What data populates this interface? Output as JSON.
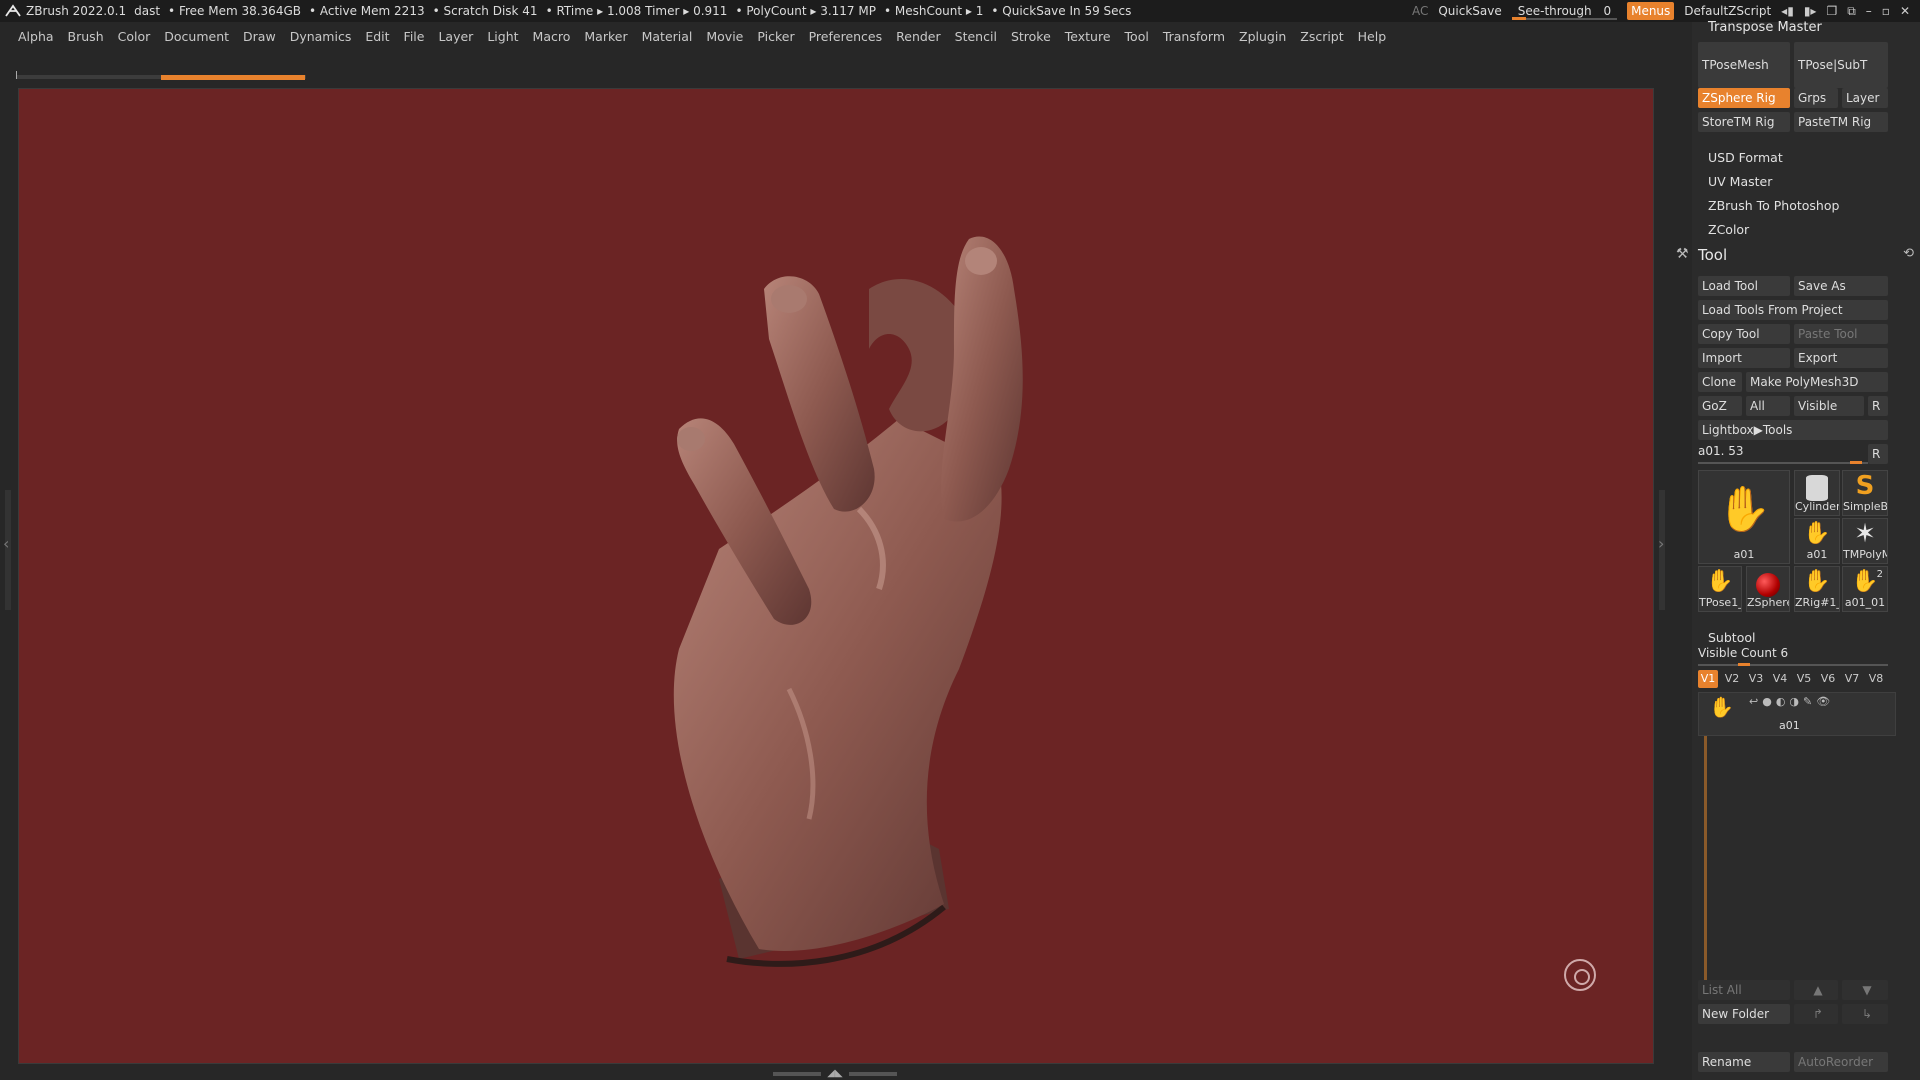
{
  "titlebar": {
    "app": "ZBrush 2022.0.1",
    "file": "dast",
    "free_mem": "• Free Mem 38.364GB",
    "active_mem": "• Active Mem 2213",
    "scratch": "• Scratch Disk 41",
    "rtime": "• RTime ▸ 1.008 Timer ▸ 0.911",
    "polycount": "• PolyCount ▸ 3.117 MP",
    "meshcount": "• MeshCount ▸ 1",
    "quicksave_in": "• QuickSave In 59 Secs",
    "ac": "AC",
    "quicksave": "QuickSave",
    "see_through_label": "See-through",
    "see_through_value": "0",
    "menus": "Menus",
    "default_zscript": "DefaultZScript"
  },
  "menubar": [
    "Alpha",
    "Brush",
    "Color",
    "Document",
    "Draw",
    "Dynamics",
    "Edit",
    "File",
    "Layer",
    "Light",
    "Macro",
    "Marker",
    "Material",
    "Movie",
    "Picker",
    "Preferences",
    "Render",
    "Stencil",
    "Stroke",
    "Texture",
    "Tool",
    "Transform",
    "Zplugin",
    "Zscript",
    "Help"
  ],
  "colors": {
    "accent": "#e8822d",
    "viewport_bg": "#6b2424",
    "panel_bg": "#2b2b2b"
  },
  "transpose_master": {
    "title": "Transpose Master",
    "tposemesh": "TPoseMesh",
    "tpose_subt": "TPose|SubT",
    "zsphere_rig": "ZSphere Rig",
    "grps": "Grps",
    "layer": "Layer",
    "store_tm_rig": "StoreTM Rig",
    "paste_tm_rig": "PasteTM Rig"
  },
  "plugins": {
    "usd_format": "USD Format",
    "uv_master": "UV Master",
    "zbrush_to_photoshop": "ZBrush To Photoshop",
    "zcolor": "ZColor"
  },
  "tool": {
    "title": "Tool",
    "load_tool": "Load Tool",
    "save_as": "Save As",
    "load_tools_from_project": "Load Tools From Project",
    "copy_tool": "Copy Tool",
    "paste_tool": "Paste Tool",
    "import": "Import",
    "export": "Export",
    "clone": "Clone",
    "make_polymesh": "Make PolyMesh3D",
    "goz": "GoZ",
    "all": "All",
    "visible": "Visible",
    "r": "R",
    "lightbox_tools": "Lightbox▶Tools",
    "current_tool": "a01. 53",
    "current_tool_r": "R",
    "thumbs": {
      "a01_large": "a01",
      "cylinder": "Cylinder",
      "simpleb": "SimpleB",
      "a01_small": "a01",
      "tmpoly": "TMPolyM",
      "tpose1": "TPose1_",
      "zsphere": "ZSphere",
      "zrig": "ZRig#1_",
      "a01_01": "a01_01",
      "a01_01_count": "2"
    }
  },
  "subtool": {
    "title": "Subtool",
    "visible_count": "Visible Count 6",
    "vtabs": [
      "V1",
      "V2",
      "V3",
      "V4",
      "V5",
      "V6",
      "V7",
      "V8"
    ],
    "item_name": "a01",
    "list_all": "List All",
    "new_folder": "New Folder",
    "rename": "Rename",
    "autoreorder": "AutoReorder"
  }
}
